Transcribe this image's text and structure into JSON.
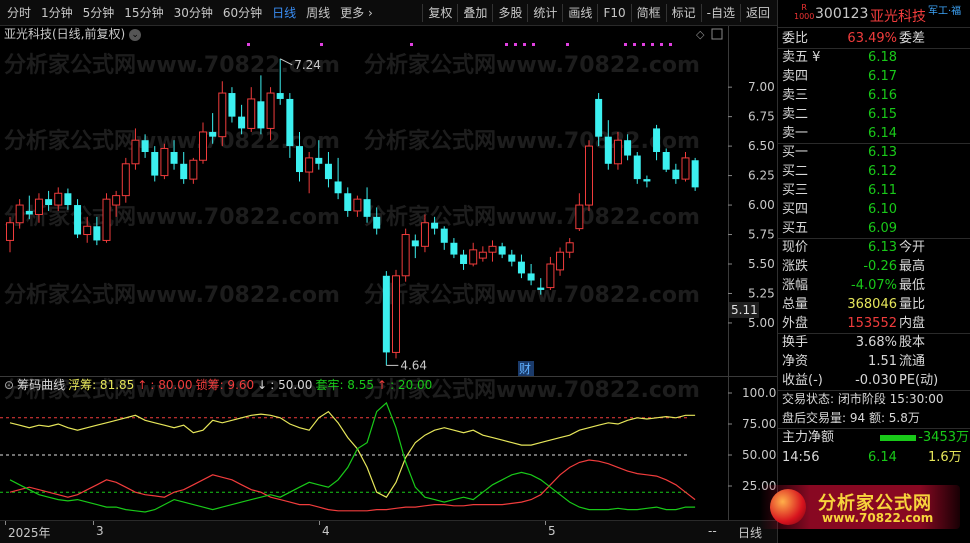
{
  "toolbar": {
    "periods": [
      "分时",
      "1分钟",
      "5分钟",
      "15分钟",
      "30分钟",
      "60分钟",
      "日线",
      "周线",
      "更多 ›"
    ],
    "active_period": "日线",
    "buttons": [
      "复权",
      "叠加",
      "多股",
      "统计",
      "画线",
      "F10",
      "简框",
      "标记",
      "-自选",
      "返回"
    ]
  },
  "chart_title": "亚光科技(日线,前复权)",
  "chart_title_icon": "⌄",
  "watermark": "分析家公式网www.70822.com",
  "main_axis": {
    "ticks": [
      "7.00",
      "6.75",
      "6.50",
      "6.25",
      "6.00",
      "5.75",
      "5.50",
      "5.25",
      "5.00"
    ],
    "current_price_label": "5.11"
  },
  "price_annotations": {
    "high": "7.24",
    "low": "4.64",
    "event_marker": "财"
  },
  "chart_data": [
    {
      "type": "candlestick",
      "title": "亚光科技(日线,前复权)",
      "ylim": [
        4.55,
        7.4
      ],
      "ohlc": [
        [
          5.7,
          5.9,
          5.6,
          5.85
        ],
        [
          5.85,
          6.05,
          5.8,
          6.0
        ],
        [
          5.95,
          6.08,
          5.88,
          5.92
        ],
        [
          5.92,
          6.1,
          5.85,
          6.05
        ],
        [
          6.05,
          6.12,
          5.95,
          6.0
        ],
        [
          6.0,
          6.15,
          5.95,
          6.1
        ],
        [
          6.1,
          6.14,
          5.96,
          6.0
        ],
        [
          6.0,
          6.05,
          5.72,
          5.75
        ],
        [
          5.75,
          5.9,
          5.68,
          5.82
        ],
        [
          5.82,
          5.9,
          5.66,
          5.7
        ],
        [
          5.7,
          6.1,
          5.68,
          6.05
        ],
        [
          6.0,
          6.12,
          5.9,
          6.08
        ],
        [
          6.08,
          6.4,
          6.02,
          6.35
        ],
        [
          6.35,
          6.65,
          6.3,
          6.55
        ],
        [
          6.55,
          6.6,
          6.4,
          6.45
        ],
        [
          6.45,
          6.5,
          6.2,
          6.25
        ],
        [
          6.25,
          6.52,
          6.22,
          6.48
        ],
        [
          6.45,
          6.55,
          6.3,
          6.35
        ],
        [
          6.35,
          6.45,
          6.18,
          6.22
        ],
        [
          6.22,
          6.4,
          6.18,
          6.38
        ],
        [
          6.38,
          6.7,
          6.35,
          6.62
        ],
        [
          6.62,
          6.78,
          6.52,
          6.58
        ],
        [
          6.58,
          7.05,
          6.5,
          6.95
        ],
        [
          6.95,
          7.0,
          6.7,
          6.75
        ],
        [
          6.75,
          6.85,
          6.6,
          6.65
        ],
        [
          6.65,
          7.0,
          6.62,
          6.9
        ],
        [
          6.88,
          7.1,
          6.6,
          6.65
        ],
        [
          6.65,
          7.0,
          6.55,
          6.95
        ],
        [
          6.95,
          7.24,
          6.85,
          6.9
        ],
        [
          6.9,
          6.95,
          6.4,
          6.5
        ],
        [
          6.5,
          6.62,
          6.2,
          6.28
        ],
        [
          6.28,
          6.45,
          6.1,
          6.4
        ],
        [
          6.4,
          6.55,
          6.3,
          6.35
        ],
        [
          6.35,
          6.45,
          6.15,
          6.22
        ],
        [
          6.2,
          6.4,
          6.05,
          6.1
        ],
        [
          6.1,
          6.15,
          5.9,
          5.95
        ],
        [
          5.95,
          6.08,
          5.9,
          6.05
        ],
        [
          6.05,
          6.15,
          5.85,
          5.9
        ],
        [
          5.9,
          5.98,
          5.75,
          5.8
        ],
        [
          5.4,
          5.44,
          4.64,
          4.75
        ],
        [
          4.75,
          5.45,
          4.7,
          5.4
        ],
        [
          5.4,
          5.8,
          5.35,
          5.75
        ],
        [
          5.7,
          5.75,
          5.55,
          5.65
        ],
        [
          5.65,
          5.92,
          5.6,
          5.85
        ],
        [
          5.85,
          5.9,
          5.75,
          5.8
        ],
        [
          5.8,
          5.82,
          5.62,
          5.68
        ],
        [
          5.68,
          5.72,
          5.55,
          5.58
        ],
        [
          5.58,
          5.62,
          5.45,
          5.5
        ],
        [
          5.5,
          5.68,
          5.48,
          5.62
        ],
        [
          5.55,
          5.65,
          5.52,
          5.6
        ],
        [
          5.6,
          5.7,
          5.52,
          5.65
        ],
        [
          5.65,
          5.68,
          5.55,
          5.58
        ],
        [
          5.58,
          5.62,
          5.48,
          5.52
        ],
        [
          5.52,
          5.58,
          5.38,
          5.42
        ],
        [
          5.42,
          5.5,
          5.32,
          5.36
        ],
        [
          5.3,
          5.38,
          5.24,
          5.28
        ],
        [
          5.3,
          5.56,
          5.28,
          5.5
        ],
        [
          5.45,
          5.64,
          5.4,
          5.6
        ],
        [
          5.6,
          5.72,
          5.55,
          5.68
        ],
        [
          5.8,
          6.1,
          5.78,
          6.0
        ],
        [
          6.0,
          6.55,
          5.95,
          6.5
        ],
        [
          6.9,
          6.95,
          6.5,
          6.58
        ],
        [
          6.58,
          6.72,
          6.3,
          6.35
        ],
        [
          6.35,
          6.62,
          6.3,
          6.55
        ],
        [
          6.55,
          6.6,
          6.38,
          6.42
        ],
        [
          6.42,
          6.45,
          6.18,
          6.22
        ],
        [
          6.22,
          6.25,
          6.15,
          6.2
        ],
        [
          6.65,
          6.68,
          6.38,
          6.45
        ],
        [
          6.45,
          6.48,
          6.28,
          6.3
        ],
        [
          6.3,
          6.35,
          6.18,
          6.22
        ],
        [
          6.22,
          6.45,
          6.2,
          6.4
        ],
        [
          6.38,
          6.4,
          6.12,
          6.15
        ]
      ]
    },
    {
      "type": "line",
      "title": "筹码曲线",
      "ylim": [
        0,
        100
      ],
      "reference_lines": [
        80,
        50,
        20
      ],
      "series": [
        {
          "name": "浮筹",
          "color": "#e6e65a",
          "values": [
            76,
            74,
            72,
            74,
            73,
            75,
            72,
            70,
            72,
            74,
            76,
            78,
            80,
            82,
            78,
            76,
            74,
            72,
            74,
            68,
            70,
            78,
            76,
            78,
            80,
            82,
            83,
            82,
            80,
            75,
            72,
            70,
            80,
            85,
            76,
            64,
            55,
            40,
            20,
            16,
            28,
            48,
            60,
            66,
            70,
            72,
            70,
            68,
            70,
            66,
            64,
            62,
            60,
            58,
            58,
            60,
            62,
            64,
            66,
            70,
            72,
            74,
            76,
            75,
            78,
            80,
            79,
            80,
            81,
            80,
            82,
            82
          ]
        },
        {
          "name": "锁筹",
          "color": "#f03c3c",
          "values": [
            20,
            22,
            24,
            22,
            20,
            18,
            16,
            18,
            22,
            26,
            30,
            28,
            24,
            20,
            18,
            17,
            16,
            20,
            22,
            26,
            30,
            34,
            32,
            30,
            26,
            22,
            20,
            16,
            14,
            12,
            10,
            10,
            8,
            6,
            5,
            5,
            5,
            5,
            6,
            6,
            7,
            8,
            8,
            9,
            10,
            10,
            9,
            9,
            10,
            10,
            10,
            10,
            11,
            12,
            14,
            18,
            26,
            34,
            40,
            44,
            46,
            45,
            43,
            40,
            37,
            35,
            34,
            33,
            30,
            26,
            20,
            14
          ]
        },
        {
          "name": "套牢",
          "color": "#19c919",
          "values": [
            30,
            26,
            22,
            18,
            16,
            14,
            13,
            14,
            12,
            10,
            8,
            8,
            6,
            5,
            4,
            6,
            10,
            14,
            12,
            10,
            8,
            6,
            8,
            10,
            12,
            14,
            16,
            18,
            16,
            20,
            24,
            28,
            26,
            24,
            30,
            40,
            55,
            60,
            85,
            92,
            72,
            44,
            24,
            16,
            14,
            12,
            14,
            16,
            14,
            20,
            26,
            30,
            34,
            36,
            34,
            30,
            24,
            18,
            12,
            8,
            6,
            6,
            6,
            7,
            6,
            6,
            7,
            8,
            6,
            6,
            8,
            8
          ]
        }
      ]
    }
  ],
  "indicator_header": {
    "name": "筹码曲线",
    "items": [
      {
        "label": "浮筹: 81.85",
        "color": "yellow",
        "arrow": "↑"
      },
      {
        "label": ": 80.00",
        "color": "red"
      },
      {
        "label": "锁筹: 9.60",
        "color": "red",
        "arrow": "↓"
      },
      {
        "label": ": 50.00",
        "color": "white"
      },
      {
        "label": "套牢: 8.55",
        "color": "green",
        "arrow": "↑"
      },
      {
        "label": ": 20.00",
        "color": "green"
      }
    ]
  },
  "indicator_axis": [
    "100.0",
    "75.00",
    "50.00",
    "25.00"
  ],
  "xaxis": {
    "labels": [
      "2025年",
      "3",
      "4",
      "5"
    ],
    "right_label": "日线",
    "scroll": "--"
  },
  "quote": {
    "code": "300123",
    "name": "亚光科技",
    "badge": "R",
    "badge_sub": "1000",
    "sector": "军工·福",
    "weibi": {
      "label": "委比",
      "value": "63.49%",
      "label2": "委差",
      "value2": ""
    },
    "sell": [
      {
        "label": "卖五 ¥",
        "price": "6.18"
      },
      {
        "label": "卖四",
        "price": "6.17"
      },
      {
        "label": "卖三",
        "price": "6.16"
      },
      {
        "label": "卖二",
        "price": "6.15"
      },
      {
        "label": "卖一",
        "price": "6.14"
      }
    ],
    "buy": [
      {
        "label": "买一",
        "price": "6.13"
      },
      {
        "label": "买二",
        "price": "6.12"
      },
      {
        "label": "买三",
        "price": "6.11"
      },
      {
        "label": "买四",
        "price": "6.10"
      },
      {
        "label": "买五",
        "price": "6.09"
      }
    ],
    "stats": [
      {
        "l1": "现价",
        "v1": "6.13",
        "c1": "green",
        "l2": "今开",
        "v2": ""
      },
      {
        "l1": "涨跌",
        "v1": "-0.26",
        "c1": "green",
        "l2": "最高",
        "v2": ""
      },
      {
        "l1": "涨幅",
        "v1": "-4.07%",
        "c1": "green",
        "l2": "最低",
        "v2": ""
      },
      {
        "l1": "总量",
        "v1": "368046",
        "c1": "yellow",
        "l2": "量比",
        "v2": ""
      },
      {
        "l1": "外盘",
        "v1": "153552",
        "c1": "red",
        "l2": "内盘",
        "v2": ""
      }
    ],
    "stats2": [
      {
        "l1": "换手",
        "v1": "3.68%",
        "c1": "white",
        "l2": "股本",
        "v2": ""
      },
      {
        "l1": "净资",
        "v1": "1.51",
        "c1": "white",
        "l2": "流通",
        "v2": ""
      },
      {
        "l1": "收益(-)",
        "v1": "-0.030",
        "c1": "white",
        "l2": "PE(动)",
        "v2": ""
      }
    ],
    "trade_status": "交易状态: 闭市阶段  15:30:00",
    "after_hours": "盘后交易量: 94  额: 5.8万",
    "main_flow_label": "主力净额",
    "main_flow_value": "-3453万",
    "last_tick": {
      "time": "14:56",
      "price": "6.14",
      "volume": "1.6万"
    }
  },
  "logo": {
    "line1": "分析家公式网",
    "line2": "www.70822.com"
  }
}
